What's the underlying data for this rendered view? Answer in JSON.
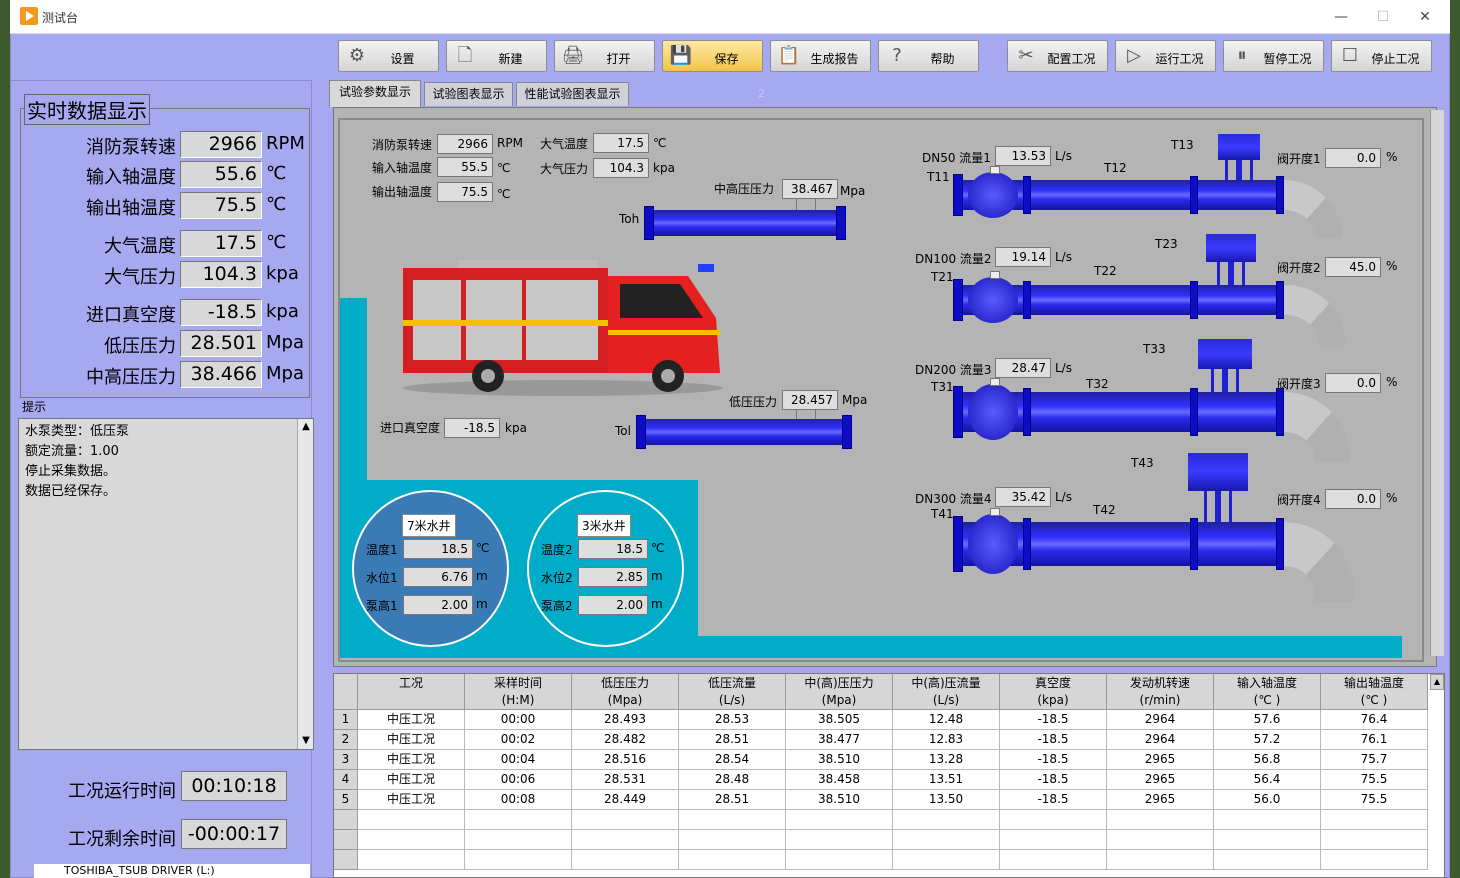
{
  "window": {
    "title": "测试台",
    "minimize": "—",
    "maximize": "☐",
    "close": "✕"
  },
  "toolbar": [
    {
      "label": "设置",
      "icon": "gear-icon",
      "glyph": "⚙"
    },
    {
      "label": "新建",
      "icon": "new-file-icon",
      "glyph": "🗋"
    },
    {
      "label": "打开",
      "icon": "open-icon",
      "glyph": "🖨"
    },
    {
      "label": "保存",
      "icon": "save-icon",
      "glyph": "💾"
    },
    {
      "label": "生成报告",
      "icon": "report-icon",
      "glyph": "📋"
    },
    {
      "label": "帮助",
      "icon": "help-icon",
      "glyph": "?"
    },
    {
      "label": "配置工况",
      "icon": "tools-icon",
      "glyph": "✂"
    },
    {
      "label": "运行工况",
      "icon": "run-icon",
      "glyph": "▷"
    },
    {
      "label": "暂停工况",
      "icon": "pause-icon",
      "glyph": "⏸"
    },
    {
      "label": "停止工况",
      "icon": "stop-icon",
      "glyph": "☐"
    }
  ],
  "realtime": {
    "title": "实时数据显示",
    "rows": [
      {
        "label": "消防泵转速",
        "value": "2966",
        "unit": "RPM"
      },
      {
        "label": "输入轴温度",
        "value": "55.6",
        "unit": "℃"
      },
      {
        "label": "输出轴温度",
        "value": "75.5",
        "unit": "℃"
      },
      {
        "label": "大气温度",
        "value": "17.5",
        "unit": "℃"
      },
      {
        "label": "大气压力",
        "value": "104.3",
        "unit": "kpa"
      },
      {
        "label": "进口真空度",
        "value": "-18.5",
        "unit": "kpa"
      },
      {
        "label": "低压压力",
        "value": "28.501",
        "unit": "Mpa"
      },
      {
        "label": "中高压压力",
        "value": "38.466",
        "unit": "Mpa"
      }
    ]
  },
  "hint": {
    "label": "提示",
    "lines": [
      "水泵类型：低压泵",
      "额定流量：1.00",
      "停止采集数据。",
      "数据已经保存。"
    ]
  },
  "timers": {
    "run_label": "工况运行时间",
    "run_value": "00:10:18",
    "remain_label": "工况剩余时间",
    "remain_value": "-00:00:17"
  },
  "tabs": [
    "试验参数显示",
    "试验图表显示",
    "性能试验图表显示"
  ],
  "tab_marker": "2",
  "params": {
    "pump_speed": {
      "label": "消防泵转速",
      "value": "2966",
      "unit": "RPM"
    },
    "in_temp": {
      "label": "输入轴温度",
      "value": "55.5",
      "unit": "℃"
    },
    "out_temp": {
      "label": "输出轴温度",
      "value": "75.5",
      "unit": "℃"
    },
    "air_temp": {
      "label": "大气温度",
      "value": "17.5",
      "unit": "℃"
    },
    "air_press": {
      "label": "大气压力",
      "value": "104.3",
      "unit": "kpa"
    },
    "mid_press": {
      "label": "中高压压力",
      "value": "38.467",
      "unit": "Mpa"
    },
    "low_press": {
      "label": "低压压力",
      "value": "28.457",
      "unit": "Mpa"
    },
    "vacuum": {
      "label": "进口真空度",
      "value": "-18.5",
      "unit": "kpa"
    },
    "toh": "Toh",
    "tol": "Tol"
  },
  "lines": [
    {
      "flow_label": "DN50 流量1",
      "flow": "13.53",
      "flow_unit": "L/s",
      "t1": "T11",
      "t2": "T12",
      "t3": "T13",
      "valve_label": "阀开度1",
      "valve": "0.0",
      "valve_unit": "%"
    },
    {
      "flow_label": "DN100 流量2",
      "flow": "19.14",
      "flow_unit": "L/s",
      "t1": "T21",
      "t2": "T22",
      "t3": "T23",
      "valve_label": "阀开度2",
      "valve": "45.0",
      "valve_unit": "%"
    },
    {
      "flow_label": "DN200 流量3",
      "flow": "28.47",
      "flow_unit": "L/s",
      "t1": "T31",
      "t2": "T32",
      "t3": "T33",
      "valve_label": "阀开度3",
      "valve": "0.0",
      "valve_unit": "%"
    },
    {
      "flow_label": "DN300 流量4",
      "flow": "35.42",
      "flow_unit": "L/s",
      "t1": "T41",
      "t2": "T42",
      "t3": "T43",
      "valve_label": "阀开度4",
      "valve": "0.0",
      "valve_unit": "%"
    }
  ],
  "wells": [
    {
      "title": "7米水井",
      "rows": [
        {
          "label": "温度1",
          "value": "18.5",
          "unit": "℃"
        },
        {
          "label": "水位1",
          "value": "6.76",
          "unit": "m"
        },
        {
          "label": "泵高1",
          "value": "2.00",
          "unit": "m"
        }
      ]
    },
    {
      "title": "3米水井",
      "rows": [
        {
          "label": "温度2",
          "value": "18.5",
          "unit": "℃"
        },
        {
          "label": "水位2",
          "value": "2.85",
          "unit": "m"
        },
        {
          "label": "泵高2",
          "value": "2.00",
          "unit": "m"
        }
      ]
    }
  ],
  "table": {
    "headers": [
      [
        "工况",
        ""
      ],
      [
        "采样时间",
        "(H:M)"
      ],
      [
        "低压压力",
        "(Mpa)"
      ],
      [
        "低压流量",
        "(L/s)"
      ],
      [
        "中(高)压压力",
        "(Mpa)"
      ],
      [
        "中(高)压流量",
        "(L/s)"
      ],
      [
        "真空度",
        "(kpa)"
      ],
      [
        "发动机转速",
        "(r/min)"
      ],
      [
        "输入轴温度",
        "(℃ )"
      ],
      [
        "输出轴温度",
        "(℃ )"
      ]
    ],
    "rows": [
      [
        "中压工况",
        "00:00",
        "28.493",
        "28.53",
        "38.505",
        "12.48",
        "-18.5",
        "2964",
        "57.6",
        "76.4"
      ],
      [
        "中压工况",
        "00:02",
        "28.482",
        "28.51",
        "38.477",
        "12.83",
        "-18.5",
        "2964",
        "57.2",
        "76.1"
      ],
      [
        "中压工况",
        "00:04",
        "28.516",
        "28.54",
        "38.510",
        "13.28",
        "-18.5",
        "2965",
        "56.8",
        "75.7"
      ],
      [
        "中压工况",
        "00:06",
        "28.531",
        "28.48",
        "38.458",
        "13.51",
        "-18.5",
        "2965",
        "56.4",
        "75.5"
      ],
      [
        "中压工况",
        "00:08",
        "28.449",
        "28.51",
        "38.510",
        "13.50",
        "-18.5",
        "2965",
        "56.0",
        "75.5"
      ]
    ],
    "row_numbers": [
      "1",
      "2",
      "3",
      "4",
      "5"
    ]
  },
  "taskbar_text": "TOSHIBA_TSUB DRIVER (L:)"
}
